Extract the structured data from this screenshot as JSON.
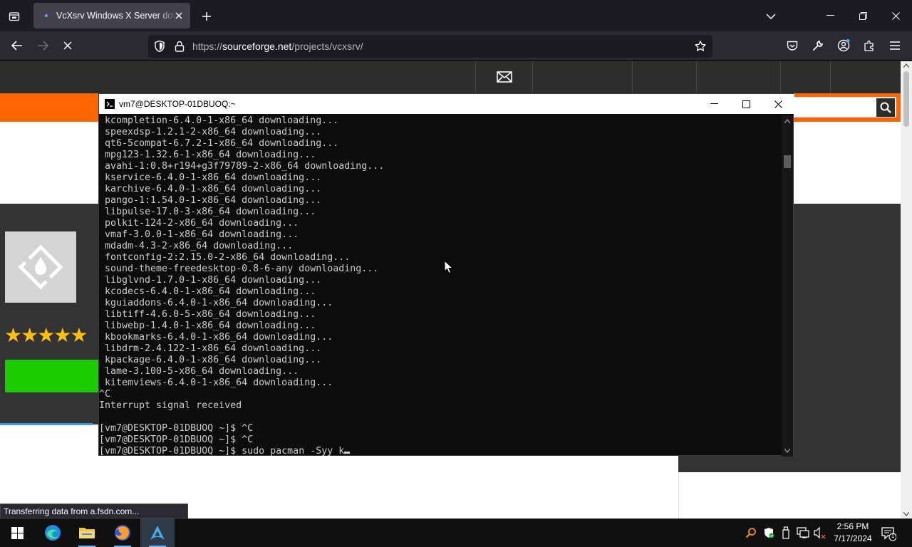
{
  "browser": {
    "tab": {
      "title": "VcXsrv Windows X Server download"
    },
    "url": {
      "scheme": "https://",
      "host": "sourceforge.net",
      "path": "/projects/vcxsrv/"
    },
    "status": "Transferring data from a.fsdn.com..."
  },
  "site": {
    "rating_stars": "★★★★★",
    "rating_value": 5,
    "colors": {
      "orange": "#ff6600",
      "download_green": "#1bcc00",
      "dark": "#333333"
    }
  },
  "terminal": {
    "title": "vm7@DESKTOP-01DBUOQ:~",
    "lines": [
      {
        "text": "kcompletion-6.4.0-1-x86_64 downloading..."
      },
      {
        "text": "speexdsp-1.2.1-2-x86_64 downloading..."
      },
      {
        "text": "qt6-5compat-6.7.2-1-x86_64 downloading..."
      },
      {
        "text": "mpg123-1.32.6-1-x86_64 downloading..."
      },
      {
        "text": "avahi-1:0.8+r194+g3f79789-2-x86_64 downloading..."
      },
      {
        "text": "kservice-6.4.0-1-x86_64 downloading..."
      },
      {
        "text": "karchive-6.4.0-1-x86_64 downloading..."
      },
      {
        "text": "pango-1:1.54.0-1-x86_64 downloading..."
      },
      {
        "text": "libpulse-17.0-3-x86_64 downloading..."
      },
      {
        "text": "polkit-124-2-x86_64 downloading..."
      },
      {
        "text": "vmaf-3.0.0-1-x86_64 downloading..."
      },
      {
        "text": "mdadm-4.3-2-x86_64 downloading..."
      },
      {
        "text": "fontconfig-2:2.15.0-2-x86_64 downloading..."
      },
      {
        "text": "sound-theme-freedesktop-0.8-6-any downloading..."
      },
      {
        "text": "libglvnd-1.7.0-1-x86_64 downloading..."
      },
      {
        "text": "kcodecs-6.4.0-1-x86_64 downloading..."
      },
      {
        "text": "kguiaddons-6.4.0-1-x86_64 downloading..."
      },
      {
        "text": "libtiff-4.6.0-5-x86_64 downloading..."
      },
      {
        "text": "libwebp-1.4.0-1-x86_64 downloading..."
      },
      {
        "text": "kbookmarks-6.4.0-1-x86_64 downloading..."
      },
      {
        "text": "libdrm-2.4.122-1-x86_64 downloading..."
      },
      {
        "text": "kpackage-6.4.0-1-x86_64 downloading..."
      },
      {
        "text": "lame-3.100-5-x86_64 downloading..."
      },
      {
        "text": "kitemviews-6.4.0-1-x86_64 downloading..."
      },
      {
        "text": "^C",
        "flush": true
      },
      {
        "text": "Interrupt signal received",
        "flush": true
      },
      {
        "text": "",
        "flush": true
      },
      {
        "text": "[vm7@DESKTOP-01DBUOQ ~]$ ^C",
        "flush": true
      },
      {
        "text": "[vm7@DESKTOP-01DBUOQ ~]$ ^C",
        "flush": true
      },
      {
        "text": "[vm7@DESKTOP-01DBUOQ ~]$ sudo pacman -Syy k",
        "flush": true,
        "cursor": true
      }
    ]
  },
  "taskbar": {
    "apps": [
      "windows-start-icon",
      "edge-icon",
      "file-explorer-icon",
      "firefox-icon",
      "arch-linux-icon"
    ],
    "clock": {
      "time": "2:56 PM",
      "date": "7/17/2024"
    },
    "notification_count": "1"
  }
}
